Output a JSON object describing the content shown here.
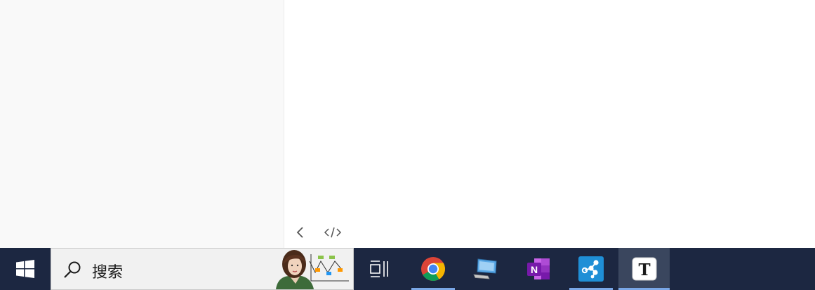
{
  "search": {
    "placeholder": "搜索"
  },
  "taskbar": {
    "items": [
      {
        "icon": "task-view-icon",
        "running": false
      },
      {
        "icon": "chrome-icon",
        "running": true
      },
      {
        "icon": "remote-desktop-icon",
        "running": false
      },
      {
        "icon": "onenote-icon",
        "running": false,
        "letter": "N"
      },
      {
        "icon": "network-app-icon",
        "running": true
      },
      {
        "icon": "typora-icon",
        "running": true,
        "active": true,
        "letter": "T"
      }
    ]
  },
  "colors": {
    "taskbar": "#1c2741",
    "accent": "#7aa7e6",
    "sidebar": "#f9f9f9"
  }
}
